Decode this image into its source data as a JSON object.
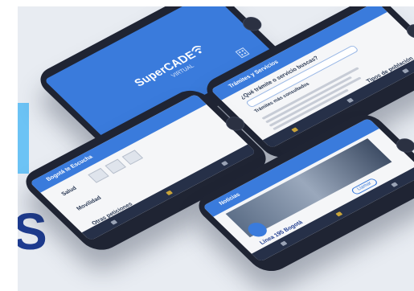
{
  "colors": {
    "stage_bg": "#e8ecf2",
    "accent": "#6cc3f5",
    "brand_blue": "#3a7bdc",
    "dark": "#1f2433",
    "letter": "#1d3b8f"
  },
  "partial_letter": "S",
  "splash": {
    "brand": "SuperCADE",
    "sub": "VIRTUAL"
  },
  "tramites_screen": {
    "header": "Trámites y Servicios",
    "question": "¿Qué trámite o servicio buscas?",
    "section": "Trámites más consultados",
    "footer": "Tipos de población"
  },
  "categories_screen": {
    "header": "Bogotá te Escucha",
    "section1": "Salud",
    "section2": "Movilidad",
    "section3": "Otras peticiones"
  },
  "detail_screen": {
    "header": "Noticias",
    "title": "Línea 195 Bogotá",
    "button": "Llamar"
  },
  "icons": [
    "wifi-icon",
    "building-icon",
    "menu-icon",
    "search-icon"
  ]
}
